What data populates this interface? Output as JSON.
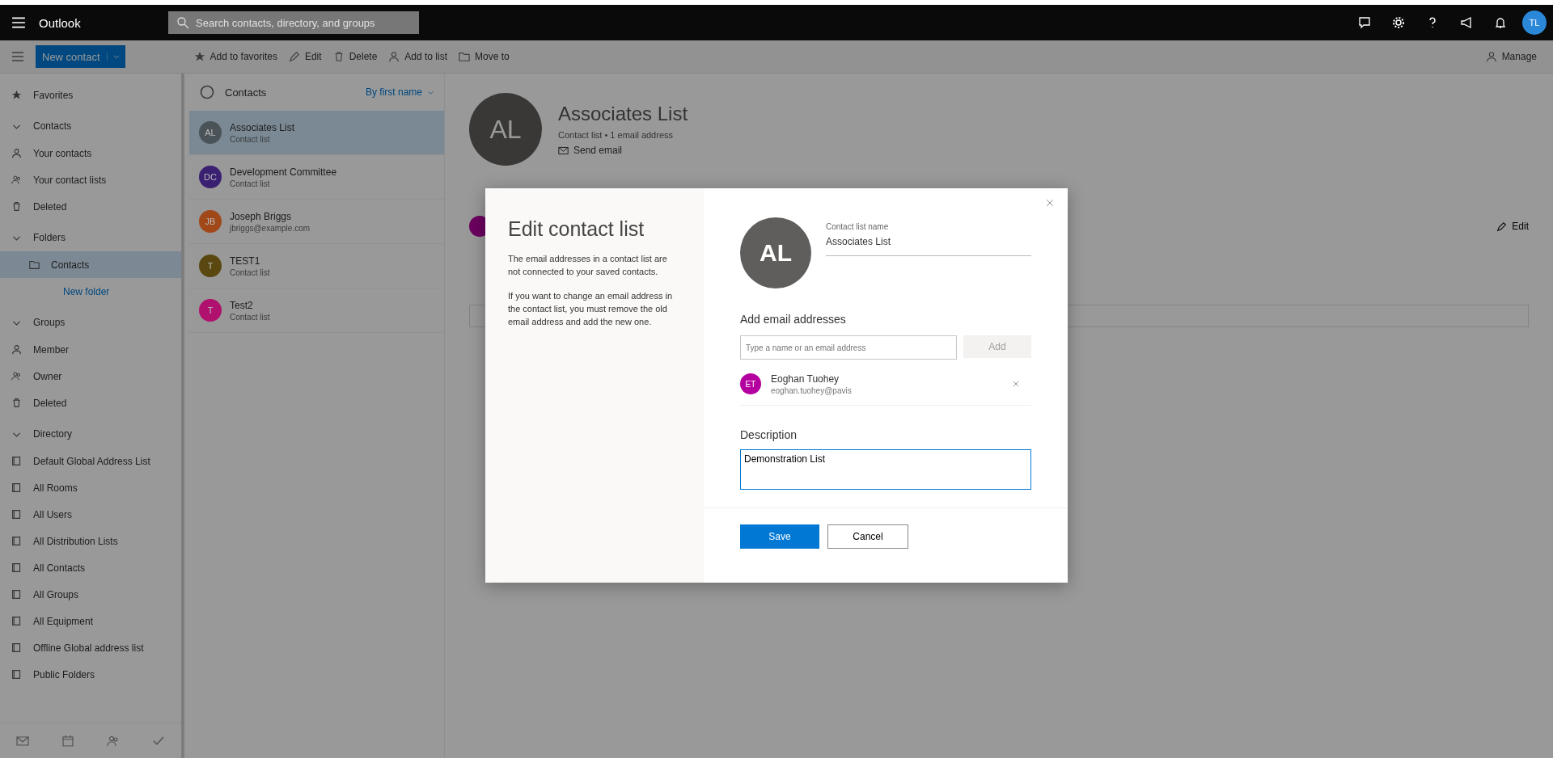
{
  "app_bar": {
    "title": "Outlook",
    "search": {
      "placeholder": "Search contacts, directory, and groups"
    },
    "avatar": "TL"
  },
  "toolbar": {
    "new_button": "New contact",
    "actions": [
      {
        "label": "Add to favorites",
        "kind": "star"
      },
      {
        "label": "Edit",
        "kind": "pen"
      },
      {
        "label": "Delete",
        "kind": "trash"
      },
      {
        "label": "Add to list",
        "kind": "person"
      },
      {
        "label": "Move to",
        "kind": "folder"
      }
    ],
    "manage": "Manage"
  },
  "nav": [
    {
      "label": "Favorites",
      "kind": "star",
      "selected": false
    },
    {
      "label": "Contacts",
      "kind": "header",
      "expanded": true,
      "selected": false
    },
    {
      "label": "Your contacts",
      "kind": "person",
      "selected": false
    },
    {
      "label": "Your contact lists",
      "kind": "people",
      "selected": false
    },
    {
      "label": "Deleted",
      "kind": "trash",
      "selected": false
    },
    {
      "label": "Folders",
      "kind": "header",
      "expanded": true,
      "selected": false
    },
    {
      "label": "Contacts",
      "kind": "subfolder",
      "selected": true
    },
    {
      "label": "New folder",
      "kind": "link",
      "selected": false
    },
    {
      "label": "Groups",
      "kind": "header",
      "expanded": true,
      "selected": false
    },
    {
      "label": "Member",
      "kind": "person",
      "selected": false
    },
    {
      "label": "Owner",
      "kind": "people",
      "selected": false
    },
    {
      "label": "Deleted",
      "kind": "trash",
      "selected": false
    },
    {
      "label": "Directory",
      "kind": "header",
      "expanded": true,
      "selected": false
    },
    {
      "label": "Default Global Address List",
      "kind": "book",
      "selected": false
    },
    {
      "label": "All Rooms",
      "kind": "book",
      "selected": false
    },
    {
      "label": "All Users",
      "kind": "book",
      "selected": false
    },
    {
      "label": "All Distribution Lists",
      "kind": "book",
      "selected": false
    },
    {
      "label": "All Contacts",
      "kind": "book",
      "selected": false
    },
    {
      "label": "All Groups",
      "kind": "book",
      "selected": false
    },
    {
      "label": "All Equipment",
      "kind": "book",
      "selected": false
    },
    {
      "label": "Offline Global address list",
      "kind": "book",
      "selected": false
    },
    {
      "label": "Public Folders",
      "kind": "book",
      "selected": false
    }
  ],
  "list": {
    "title": "Contacts",
    "sort": "By first name",
    "rows": [
      {
        "initials": "AL",
        "name": "Associates List",
        "detail": "Contact list",
        "color": "#4a5357",
        "selected": true
      },
      {
        "initials": "DC",
        "name": "Development Committee",
        "detail": "Contact list",
        "color": "#3a2070",
        "selected": false
      },
      {
        "initials": "JB",
        "name": "Joseph Briggs",
        "detail": "jbriggs@example.com",
        "color": "#a04818",
        "selected": false
      },
      {
        "initials": "T",
        "name": "TEST1",
        "detail": "Contact list",
        "color": "#5a4810",
        "selected": false
      },
      {
        "initials": "T",
        "name": "Test2",
        "detail": "Contact list",
        "color": "#b0106e",
        "selected": false
      }
    ]
  },
  "detail": {
    "initials": "AL",
    "name": "Associates List",
    "subtitle": "Contact list • 1 email address",
    "send": "Send email",
    "edit": "Edit"
  },
  "dialog": {
    "title": "Edit contact list",
    "paragraphs": [
      "The email addresses in a contact list are not connected to your saved contacts.",
      "If you want to change an email address in the contact list, you must remove the old email address and add the new one."
    ],
    "initials": "AL",
    "name_label": "Contact list name",
    "name_value": "Associates List",
    "add_heading": "Add email addresses",
    "add_placeholder": "Type a name or an email address",
    "add_button": {
      "label": "Add",
      "disabled": true
    },
    "members": [
      {
        "initials": "ET",
        "name": "Eoghan Tuohey",
        "email": "eoghan.tuohey@pavis",
        "color": "#b4009e"
      }
    ],
    "description_label": "Description",
    "description": "Demonstration List",
    "save": "Save",
    "cancel": "Cancel"
  }
}
